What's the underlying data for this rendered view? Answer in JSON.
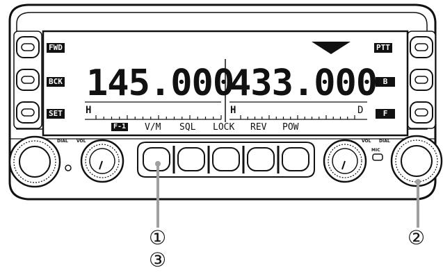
{
  "display": {
    "left_labels": [
      "FWD",
      "BCK",
      "SET"
    ],
    "right_labels": [
      "PTT",
      "B",
      "F"
    ],
    "freq_a": "145.000",
    "freq_b": "433.000",
    "meter_a_level": "H",
    "meter_b_level": "H",
    "meter_b_flag": "D",
    "menu_page": "F-1",
    "menu_items": [
      "V/M",
      "SQL",
      "LOCK",
      "REV",
      "POW"
    ]
  },
  "knobs": {
    "left_outer": "DIAL",
    "left_inner": "VOL",
    "right_inner": "VOL",
    "right_outer": "DIAL",
    "mic_label": "MIC"
  },
  "callouts": [
    "①",
    "②",
    "③"
  ],
  "colors": {
    "body": "#ffffff",
    "lcd": "#ffffff",
    "ink": "#111111",
    "pointer": "#a0a0a0"
  }
}
